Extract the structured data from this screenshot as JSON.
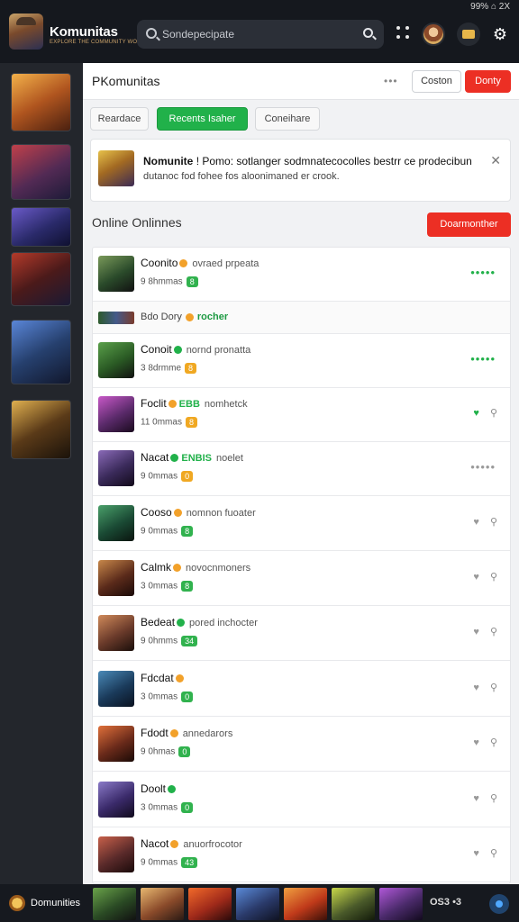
{
  "status_bar": {
    "text": "99% ⌂ 2X"
  },
  "app": {
    "title": "Komunitas",
    "subtitle": "EXPLORE THE COMMUNITY WORLD",
    "search_placeholder": "Sondepecipate"
  },
  "main": {
    "title": "PKomunitas",
    "more_label": "•••",
    "btn_outline": "Coston",
    "btn_red": "Donty",
    "tabs": [
      {
        "label": "Reardace"
      },
      {
        "label": "Recents Isaher"
      },
      {
        "label": "Coneihare"
      }
    ],
    "notice": {
      "title": "Nomunite",
      "body_line1": "! Pomo: sotlanger sodmnatecocolles bestrr ce prodecibun",
      "body_line2": "dutanoc fod fohee fos aloonimaned er crook.",
      "close_label": "✕"
    },
    "online_title": "Online Onlinnes",
    "online_btn": "Doarmonther",
    "group_label": "Bdo Dory",
    "group_highlight": "rocher",
    "rows": [
      {
        "name": "Coonito",
        "badge": "orange",
        "desc": "ovraed prpeata",
        "sub": "9 8hmmas",
        "pill": "8",
        "pill_color": "green",
        "action": "dots-green"
      },
      {
        "name": "Conoit",
        "badge": "green",
        "desc": "nornd pronatta",
        "sub": "3 8drmme",
        "pill": "8",
        "pill_color": "orange",
        "action": "dots-green"
      },
      {
        "name": "Foclit",
        "badge": "orange",
        "desc": "nomhetck",
        "badge_text": "EBB",
        "sub": "11 0mmas",
        "pill": "8",
        "pill_color": "orange",
        "action": "icons-green"
      },
      {
        "name": "Nacat",
        "badge": "green",
        "desc": "noelet",
        "badge_text": "ENBIS",
        "sub": "9 0mmas",
        "pill": "0",
        "pill_color": "orange",
        "action": "dots-grey"
      },
      {
        "name": "Cooso",
        "badge": "orange",
        "desc": "nomnon fuoater",
        "sub": "9 0mmas",
        "pill": "8",
        "pill_color": "green",
        "action": "icons"
      },
      {
        "name": "Calmk",
        "badge": "orange",
        "desc": "novocnmoners",
        "sub": "3 0mmas",
        "pill": "8",
        "pill_color": "green",
        "action": "icons"
      },
      {
        "name": "Bedeat",
        "badge": "green",
        "desc": "pored inchocter",
        "sub": "9 0hmms",
        "pill": "34",
        "pill_color": "green",
        "action": "icons"
      },
      {
        "name": "Fdcdat",
        "badge": "orange",
        "desc": "",
        "sub": "3 0mmas",
        "pill": "0",
        "pill_color": "green",
        "action": "icons"
      },
      {
        "name": "Fdodt",
        "badge": "orange",
        "desc": "annedarors",
        "sub": "9 0hmas",
        "pill": "0",
        "pill_color": "green",
        "action": "icons"
      },
      {
        "name": "Doolt",
        "badge": "green",
        "desc": "",
        "sub": "3 0mmas",
        "pill": "0",
        "pill_color": "green",
        "action": "icons"
      },
      {
        "name": "Nacot",
        "badge": "orange",
        "desc": "anuorfrocotor",
        "sub": "9 0mmas",
        "pill": "43",
        "pill_color": "green",
        "action": "icons"
      }
    ]
  },
  "bottom_bar": {
    "label": "Domunities",
    "misc": "OS3 •3"
  },
  "colors": {
    "accent_green": "#21b14a",
    "accent_red": "#ec2f24",
    "dark_bg": "#15181e"
  }
}
